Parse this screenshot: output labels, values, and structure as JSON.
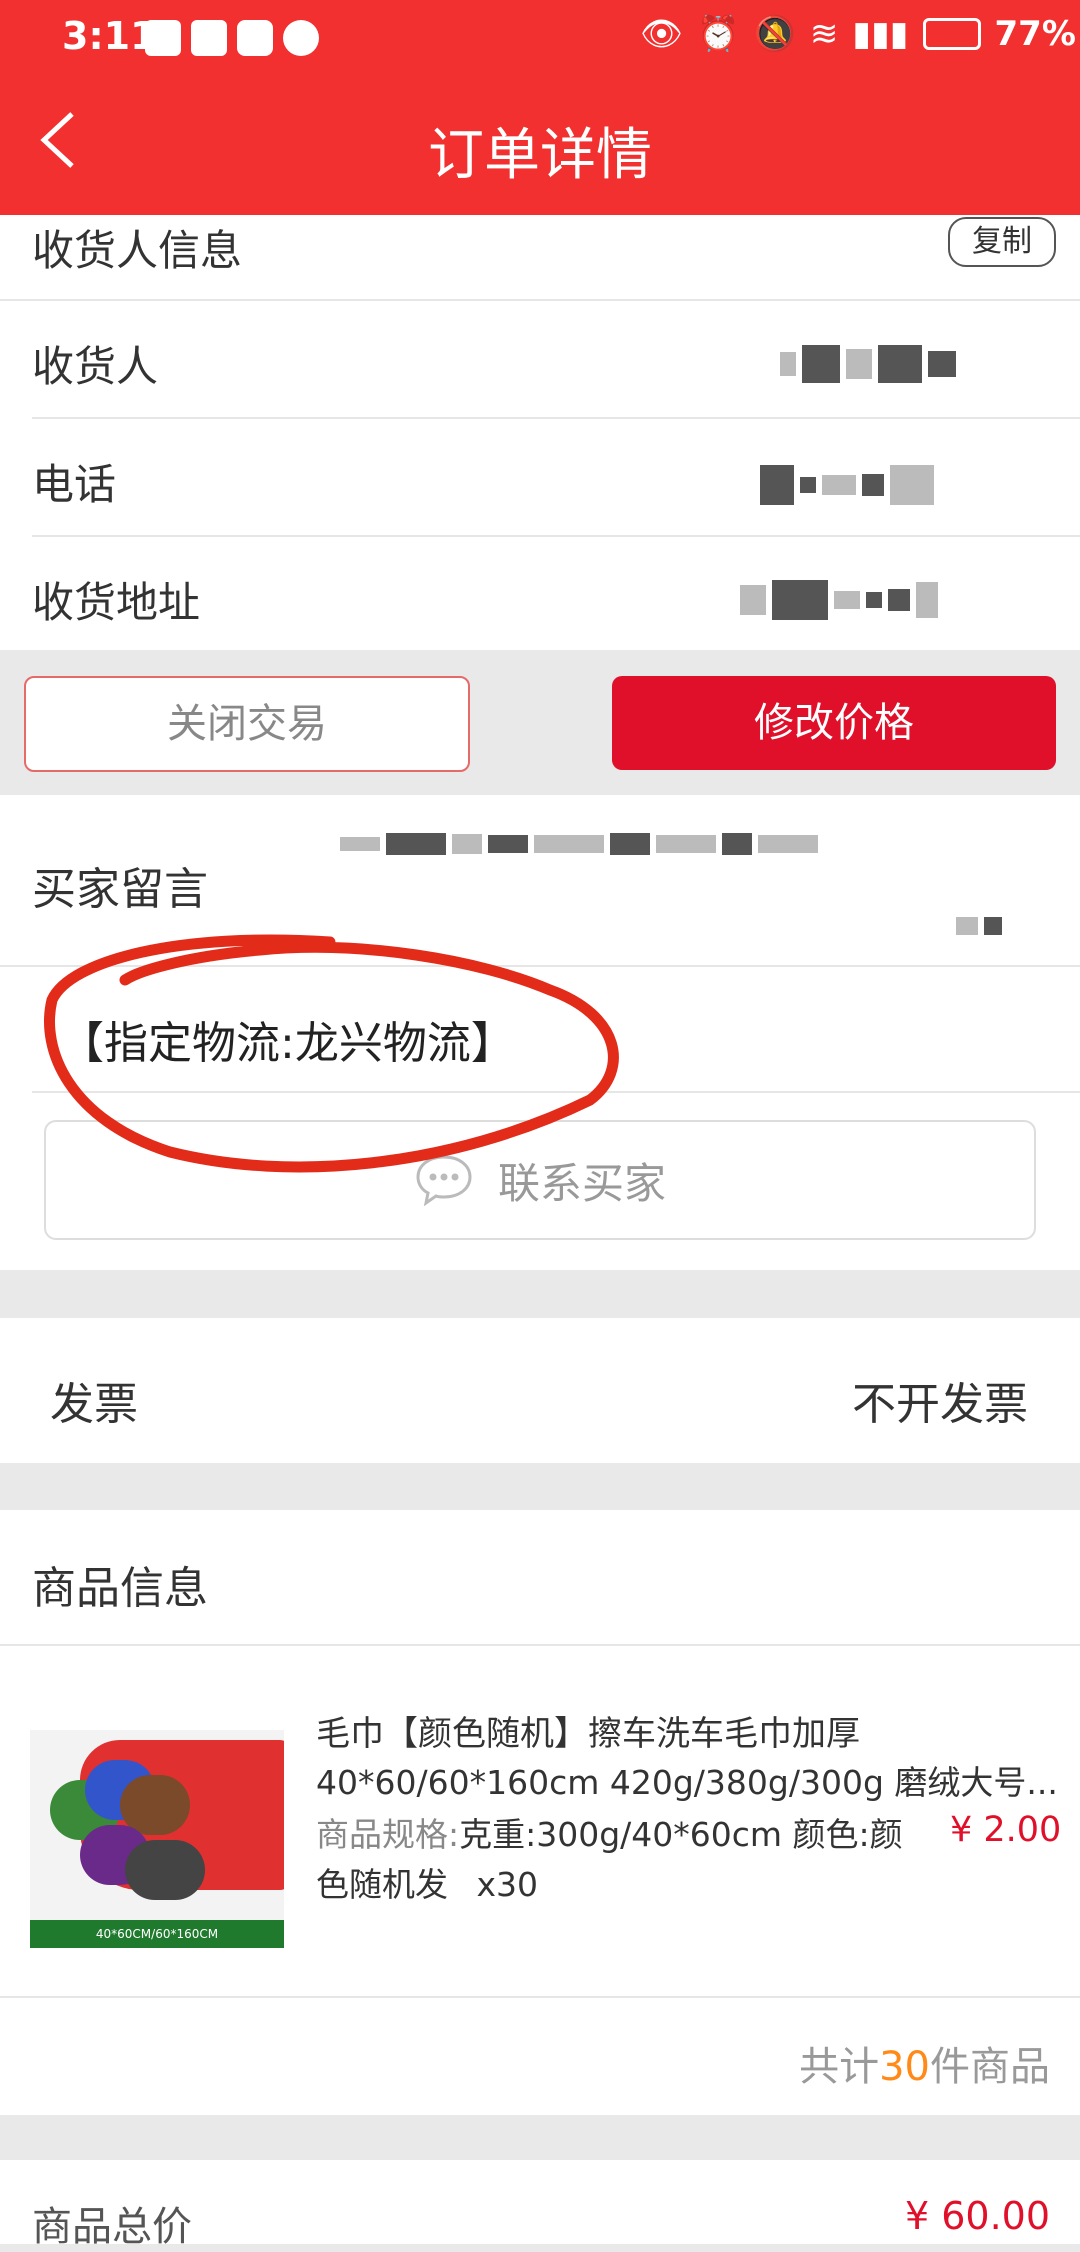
{
  "status_bar": {
    "time": "3:11",
    "battery": "77%",
    "icons": [
      "app-icon",
      "app-icon",
      "chat-icon",
      "browser-icon",
      "eye-icon",
      "alarm-icon",
      "mute-icon",
      "wifi-icon",
      "signal-icon",
      "battery-icon"
    ]
  },
  "header": {
    "title": "订单详情"
  },
  "receiver": {
    "section_label": "收货人信息",
    "copy_label": "复制",
    "name_label": "收货人",
    "phone_label": "电话",
    "address_label": "收货地址"
  },
  "actions": {
    "close_label": "关闭交易",
    "edit_price_label": "修改价格"
  },
  "buyer_message": {
    "label": "买家留言",
    "note": "【指定物流:龙兴物流】",
    "contact_label": "联系买家"
  },
  "invoice": {
    "label": "发票",
    "value": "不开发票"
  },
  "product": {
    "section_label": "商品信息",
    "title": "毛巾【颜色随机】擦车洗车毛巾加厚",
    "subtitle": "40*60/60*160cm 420g/380g/300g 磨绒大号...",
    "spec_prefix": "商品规格:",
    "spec_value": "克重:300g/40*60cm 颜色:颜",
    "spec_value2": "色随机发",
    "qty": "x30",
    "unit_price": "¥ 2.00",
    "image_caption": "40*60CM/60*160CM",
    "total_prefix": "共计",
    "total_count": "30",
    "total_suffix": "件商品"
  },
  "summary": {
    "total_label": "商品总价",
    "total_value": "¥ 60.00"
  },
  "colors": {
    "header_red": "#f23030",
    "button_red": "#e0102a",
    "highlight_orange": "#ff8a18",
    "annotation_red": "#e32b1a"
  }
}
